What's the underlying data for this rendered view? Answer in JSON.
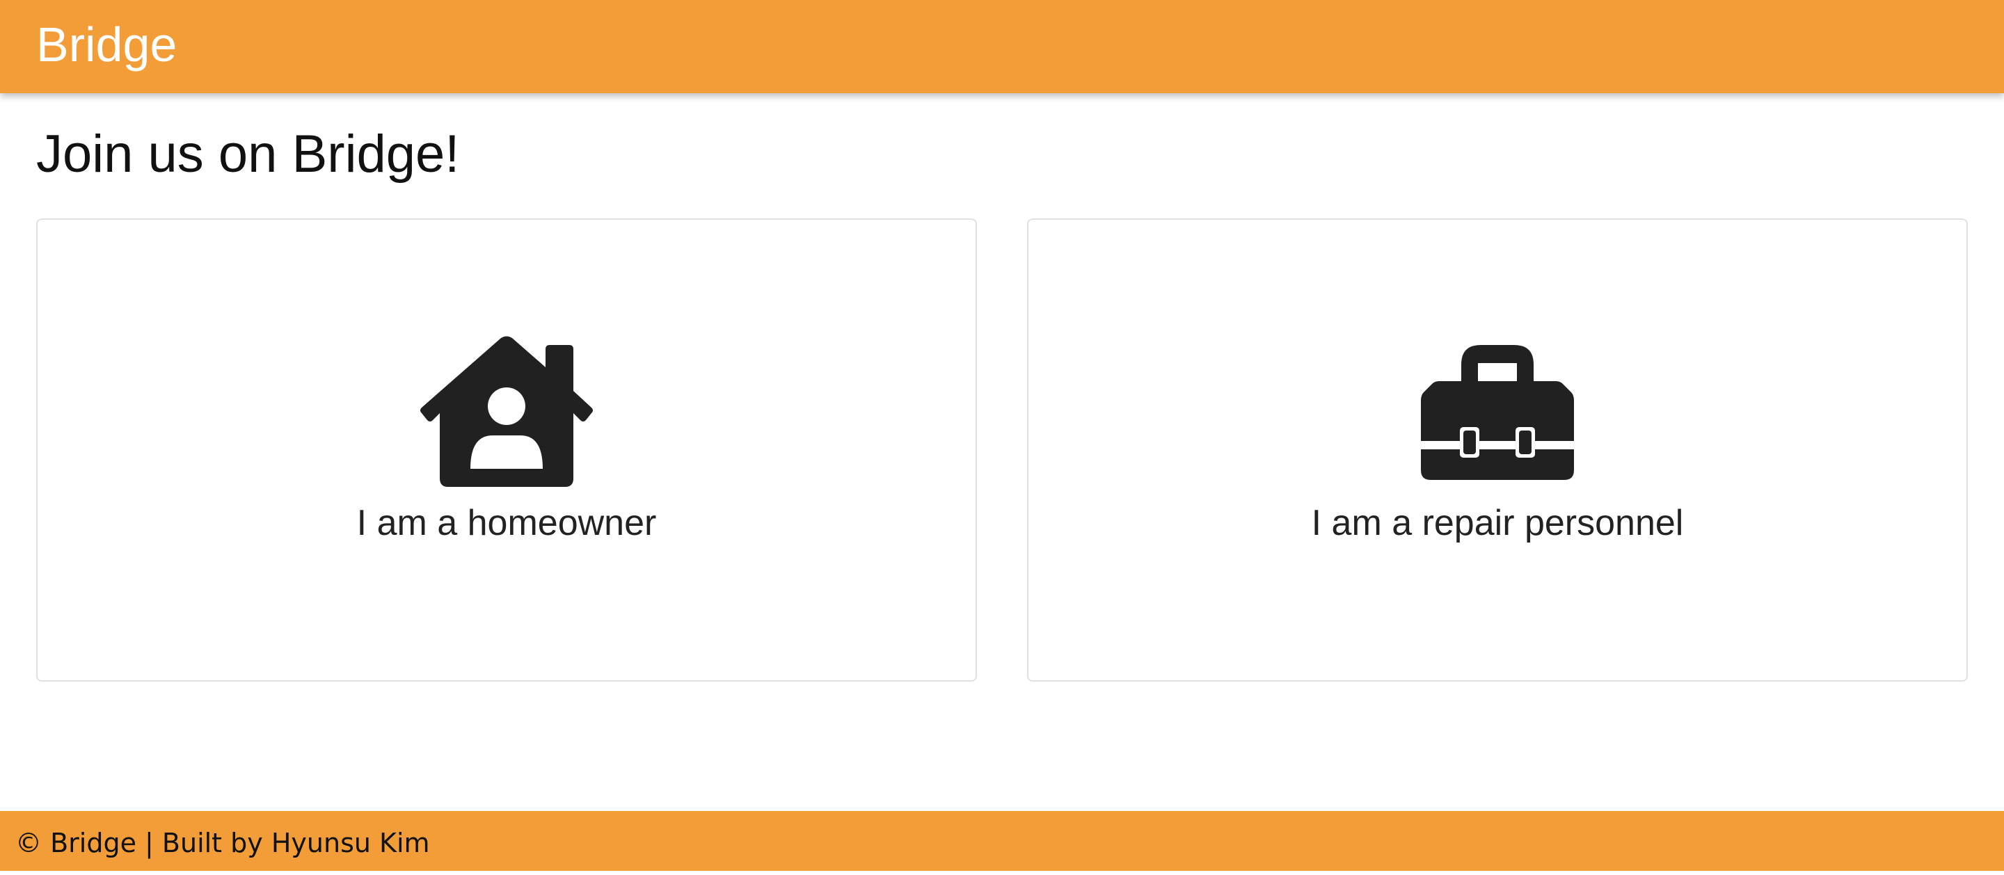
{
  "header": {
    "brand": "Bridge",
    "background_color": "#f29d38"
  },
  "main": {
    "title": "Join us on Bridge!",
    "cards": [
      {
        "label": "I am a homeowner",
        "icon": "house-user-icon"
      },
      {
        "label": "I am a repair personnel",
        "icon": "toolbox-icon"
      }
    ]
  },
  "footer": {
    "text": "© Bridge | Built by Hyunsu Kim",
    "background_color": "#f29d38"
  }
}
